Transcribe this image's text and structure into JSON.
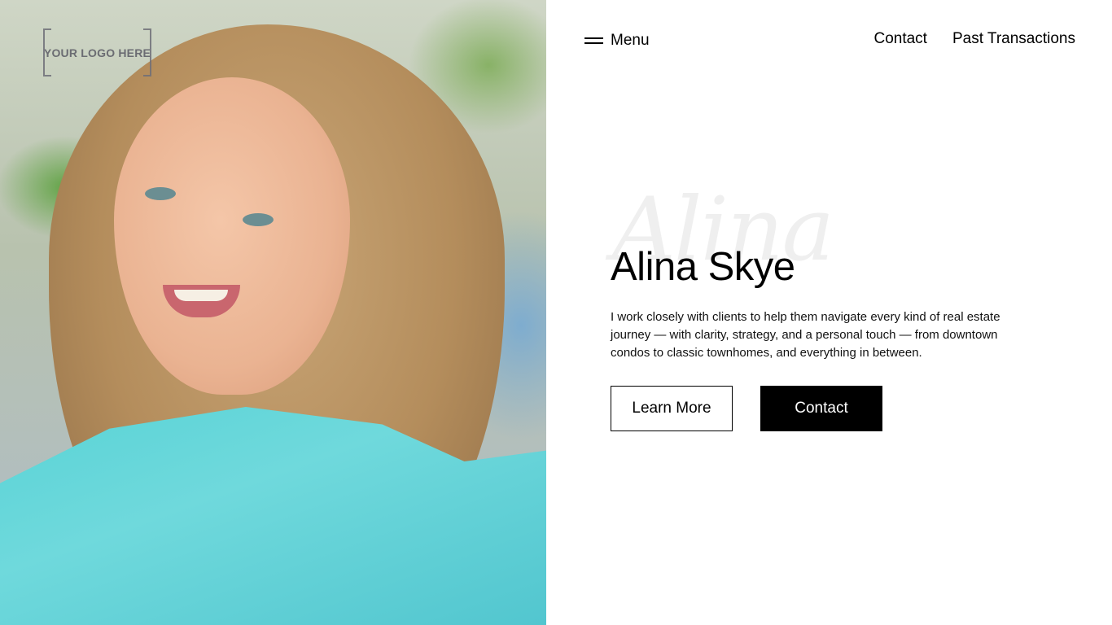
{
  "brand": {
    "logo_text": "YOUR LOGO HERE"
  },
  "nav": {
    "menu_label": "Menu",
    "links": [
      "Contact",
      "Past Transactions"
    ]
  },
  "hero": {
    "script_name": "Alina",
    "name": "Alina Skye",
    "bio": "I work closely with clients to help them navigate every kind of real estate journey — with clarity, strategy, and a personal touch — from downtown condos to classic townhomes, and everything in between.",
    "learn_more_label": "Learn More",
    "contact_label": "Contact"
  },
  "colors": {
    "background": "#ffffff",
    "text": "#000000",
    "primary_button": "#000000",
    "script_watermark": "#efefef"
  },
  "icons": {
    "menu": "hamburger-icon"
  }
}
